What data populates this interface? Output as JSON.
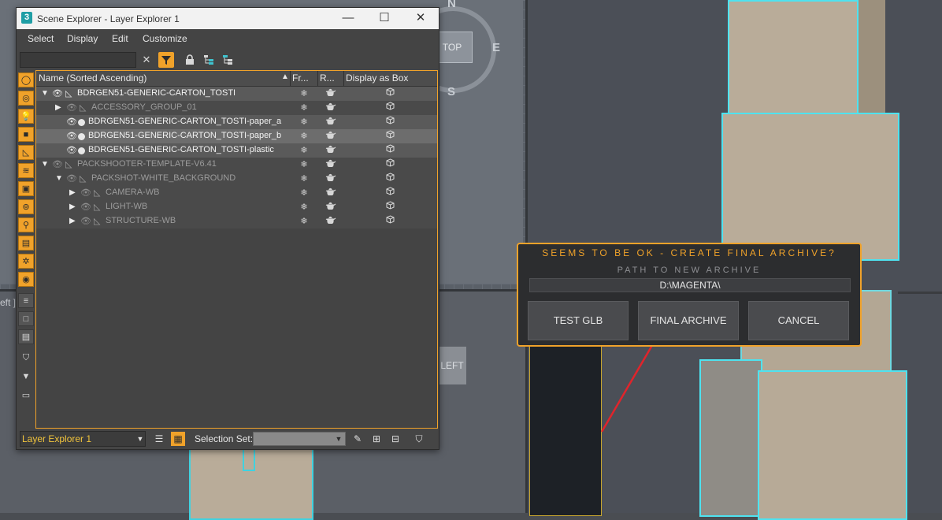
{
  "viewports": {
    "compass": {
      "n": "N",
      "e": "E",
      "s": "S"
    },
    "top_cube_label": "TOP",
    "left_cube_label": "LEFT",
    "left_viewport_label": "eft ]"
  },
  "scene_explorer": {
    "window_title": "Scene Explorer - Layer Explorer 1",
    "app_icon": "3",
    "window_buttons": {
      "minimize": "—",
      "maximize": "☐",
      "close": "✕"
    },
    "menu": [
      "Select",
      "Display",
      "Edit",
      "Customize"
    ],
    "search_value": "",
    "columns": {
      "name": "Name (Sorted Ascending)",
      "frozen": "Fr...",
      "render": "R...",
      "display_as_box": "Display as Box"
    },
    "rows": [
      {
        "name": "BDRGEN51-GENERIC-CARTON_TOSTI",
        "indent": 0,
        "expanded": true,
        "visible": true,
        "kind": "layer",
        "style": "lit"
      },
      {
        "name": "ACCESSORY_GROUP_01",
        "indent": 1,
        "expanded": false,
        "visible": false,
        "kind": "layer",
        "style": "dim"
      },
      {
        "name": "BDRGEN51-GENERIC-CARTON_TOSTI-paper_a",
        "indent": 1,
        "visible": true,
        "kind": "object",
        "style": "lit"
      },
      {
        "name": "BDRGEN51-GENERIC-CARTON_TOSTI-paper_b",
        "indent": 1,
        "visible": true,
        "kind": "object",
        "style": "sel"
      },
      {
        "name": "BDRGEN51-GENERIC-CARTON_TOSTI-plastic",
        "indent": 1,
        "visible": true,
        "kind": "object",
        "style": "lit"
      },
      {
        "name": "PACKSHOOTER-TEMPLATE-V6.41",
        "indent": 0,
        "expanded": true,
        "visible": false,
        "kind": "layer",
        "style": "dim"
      },
      {
        "name": "PACKSHOT-WHITE_BACKGROUND",
        "indent": 1,
        "expanded": true,
        "visible": false,
        "kind": "layer",
        "style": "dim"
      },
      {
        "name": "CAMERA-WB",
        "indent": 2,
        "expanded": false,
        "visible": false,
        "kind": "layer",
        "style": "dim"
      },
      {
        "name": "LIGHT-WB",
        "indent": 2,
        "expanded": false,
        "visible": false,
        "kind": "layer",
        "style": "dim"
      },
      {
        "name": "STRUCTURE-WB",
        "indent": 2,
        "expanded": false,
        "visible": false,
        "kind": "layer",
        "style": "dim"
      }
    ],
    "cell_icons": {
      "frozen": "❄",
      "render": "teapot-icon",
      "box": "cube-icon"
    },
    "layer_explorer_value": "Layer Explorer 1",
    "selection_set_label": "Selection Set:",
    "selection_set_value": ""
  },
  "dialog": {
    "title": "SEEMS TO BE OK - CREATE FINAL ARCHIVE?",
    "subtitle": "PATH TO NEW ARCHIVE",
    "path": "D:\\MAGENTA\\",
    "buttons": {
      "test": "TEST GLB",
      "final": "FINAL ARCHIVE",
      "cancel": "CANCEL"
    },
    "accent_color": "#f0a22a"
  },
  "colors": {
    "accent": "#f0a22a",
    "selection_outline": "#4ee3f0",
    "arrow": "#e0242b"
  }
}
